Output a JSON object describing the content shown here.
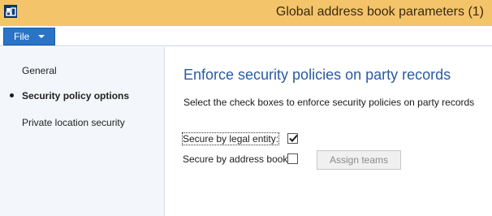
{
  "window": {
    "title": "Global address book parameters (1)",
    "app_icon": "dynamics-ax-icon"
  },
  "menubar": {
    "file_label": "File"
  },
  "nav": {
    "items": [
      {
        "label": "General",
        "active": false
      },
      {
        "label": "Security policy options",
        "active": true
      },
      {
        "label": "Private location security",
        "active": false
      }
    ]
  },
  "content": {
    "title": "Enforce security policies on party records",
    "description": "Select the check boxes to enforce security policies on party records",
    "fields": [
      {
        "label": "Secure by legal entity:",
        "checked": true
      },
      {
        "label": "Secure by address book:",
        "checked": false
      }
    ],
    "assign_button_label": "Assign teams",
    "assign_button_enabled": false
  },
  "colors": {
    "titlebar": "#f4c46a",
    "file_button": "#2b73c7",
    "heading": "#2a5aa0"
  }
}
